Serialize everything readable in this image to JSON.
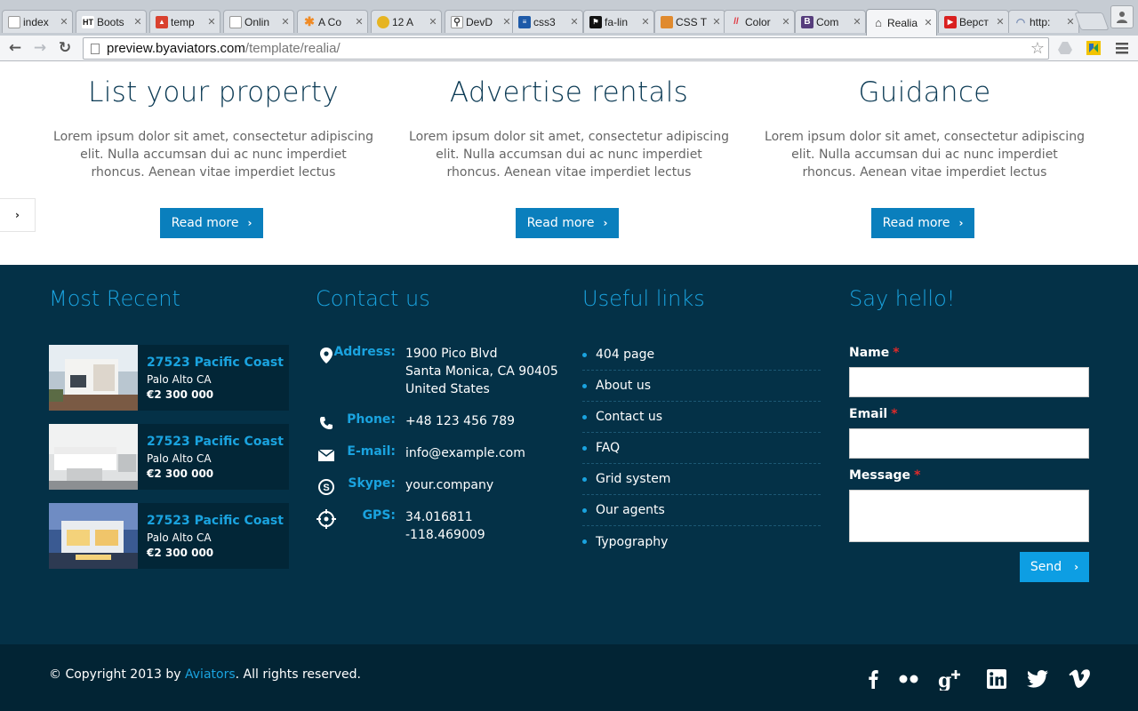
{
  "browser": {
    "tabs": [
      {
        "title": "index",
        "favicon": "page-icon",
        "color": "#ffffff"
      },
      {
        "title": "Boots",
        "favicon": "ht-icon",
        "color": "#ffffff"
      },
      {
        "title": "temp",
        "favicon": "image-icon",
        "color": "#d9412f"
      },
      {
        "title": "Onlin",
        "favicon": "page-icon",
        "color": "#ffffff"
      },
      {
        "title": "A Co",
        "favicon": "asterisk-icon",
        "color": "#f08a24"
      },
      {
        "title": "12 A",
        "favicon": "bulb-icon",
        "color": "#e6b422"
      },
      {
        "title": "DevD",
        "favicon": "search-icon",
        "color": "#ffffff"
      },
      {
        "title": "css3",
        "favicon": "stack-icon",
        "color": "#1e5aa8"
      },
      {
        "title": "fa-lin",
        "favicon": "flag-icon",
        "color": "#111111"
      },
      {
        "title": "CSS T",
        "favicon": "tiger-icon",
        "color": "#e08a2e"
      },
      {
        "title": "Color",
        "favicon": "colorzilla-icon",
        "color": "#e0303a"
      },
      {
        "title": "Com",
        "favicon": "bootstrap-icon",
        "color": "#563d7c"
      },
      {
        "title": "Realia",
        "favicon": "house-icon",
        "color": "#ffffff"
      },
      {
        "title": "Верст",
        "favicon": "youtube-icon",
        "color": "#d92020"
      },
      {
        "title": "http:",
        "favicon": "loading-icon",
        "color": "#ffffff"
      }
    ],
    "active_tab": 12,
    "url_host": "preview.byaviators.com",
    "url_path": "/template/realia/"
  },
  "features": [
    {
      "title": "List your property",
      "text": "Lorem ipsum dolor sit amet, consectetur adipiscing elit. Nulla accumsan dui ac nunc imperdiet rhoncus. Aenean vitae imperdiet lectus",
      "button": "Read more"
    },
    {
      "title": "Advertise rentals",
      "text": "Lorem ipsum dolor sit amet, consectetur adipiscing elit. Nulla accumsan dui ac nunc imperdiet rhoncus. Aenean vitae imperdiet lectus",
      "button": "Read more"
    },
    {
      "title": "Guidance",
      "text": "Lorem ipsum dolor sit amet, consectetur adipiscing elit. Nulla accumsan dui ac nunc imperdiet rhoncus. Aenean vitae imperdiet lectus",
      "button": "Read more"
    }
  ],
  "most_recent": {
    "title": "Most Recent",
    "items": [
      {
        "name": "27523 Pacific Coast",
        "location": "Palo Alto CA",
        "price": "€2 300 000"
      },
      {
        "name": "27523 Pacific Coast",
        "location": "Palo Alto CA",
        "price": "€2 300 000"
      },
      {
        "name": "27523 Pacific Coast",
        "location": "Palo Alto CA",
        "price": "€2 300 000"
      }
    ]
  },
  "contact": {
    "title": "Contact us",
    "address_label": "Address:",
    "address_lines": [
      "1900 Pico Blvd",
      "Santa Monica, CA 90405",
      "United States"
    ],
    "phone_label": "Phone:",
    "phone": "+48 123 456 789",
    "email_label": "E-mail:",
    "email": "info@example.com",
    "skype_label": "Skype:",
    "skype": "your.company",
    "gps_label": "GPS:",
    "gps_lat": "34.016811",
    "gps_lng": "-118.469009"
  },
  "useful_links": {
    "title": "Useful links",
    "items": [
      "404 page",
      "About us",
      "Contact us",
      "FAQ",
      "Grid system",
      "Our agents",
      "Typography"
    ]
  },
  "say_hello": {
    "title": "Say hello!",
    "name_label": "Name",
    "email_label": "Email",
    "message_label": "Message",
    "required_mark": "*",
    "send_button": "Send"
  },
  "footer": {
    "copyright_prefix": "© Copyright 2013 by ",
    "copyright_brand": "Aviators",
    "copyright_suffix": ". All rights reserved.",
    "social": [
      "facebook-icon",
      "flickr-icon",
      "google-plus-icon",
      "linkedin-icon",
      "twitter-icon",
      "vimeo-icon"
    ]
  },
  "colors": {
    "accent": "#1aa3df",
    "button": "#0a7fbd",
    "footer_bg": "#043147",
    "footer_bottom_bg": "#022434",
    "heading": "#0b3a54"
  }
}
